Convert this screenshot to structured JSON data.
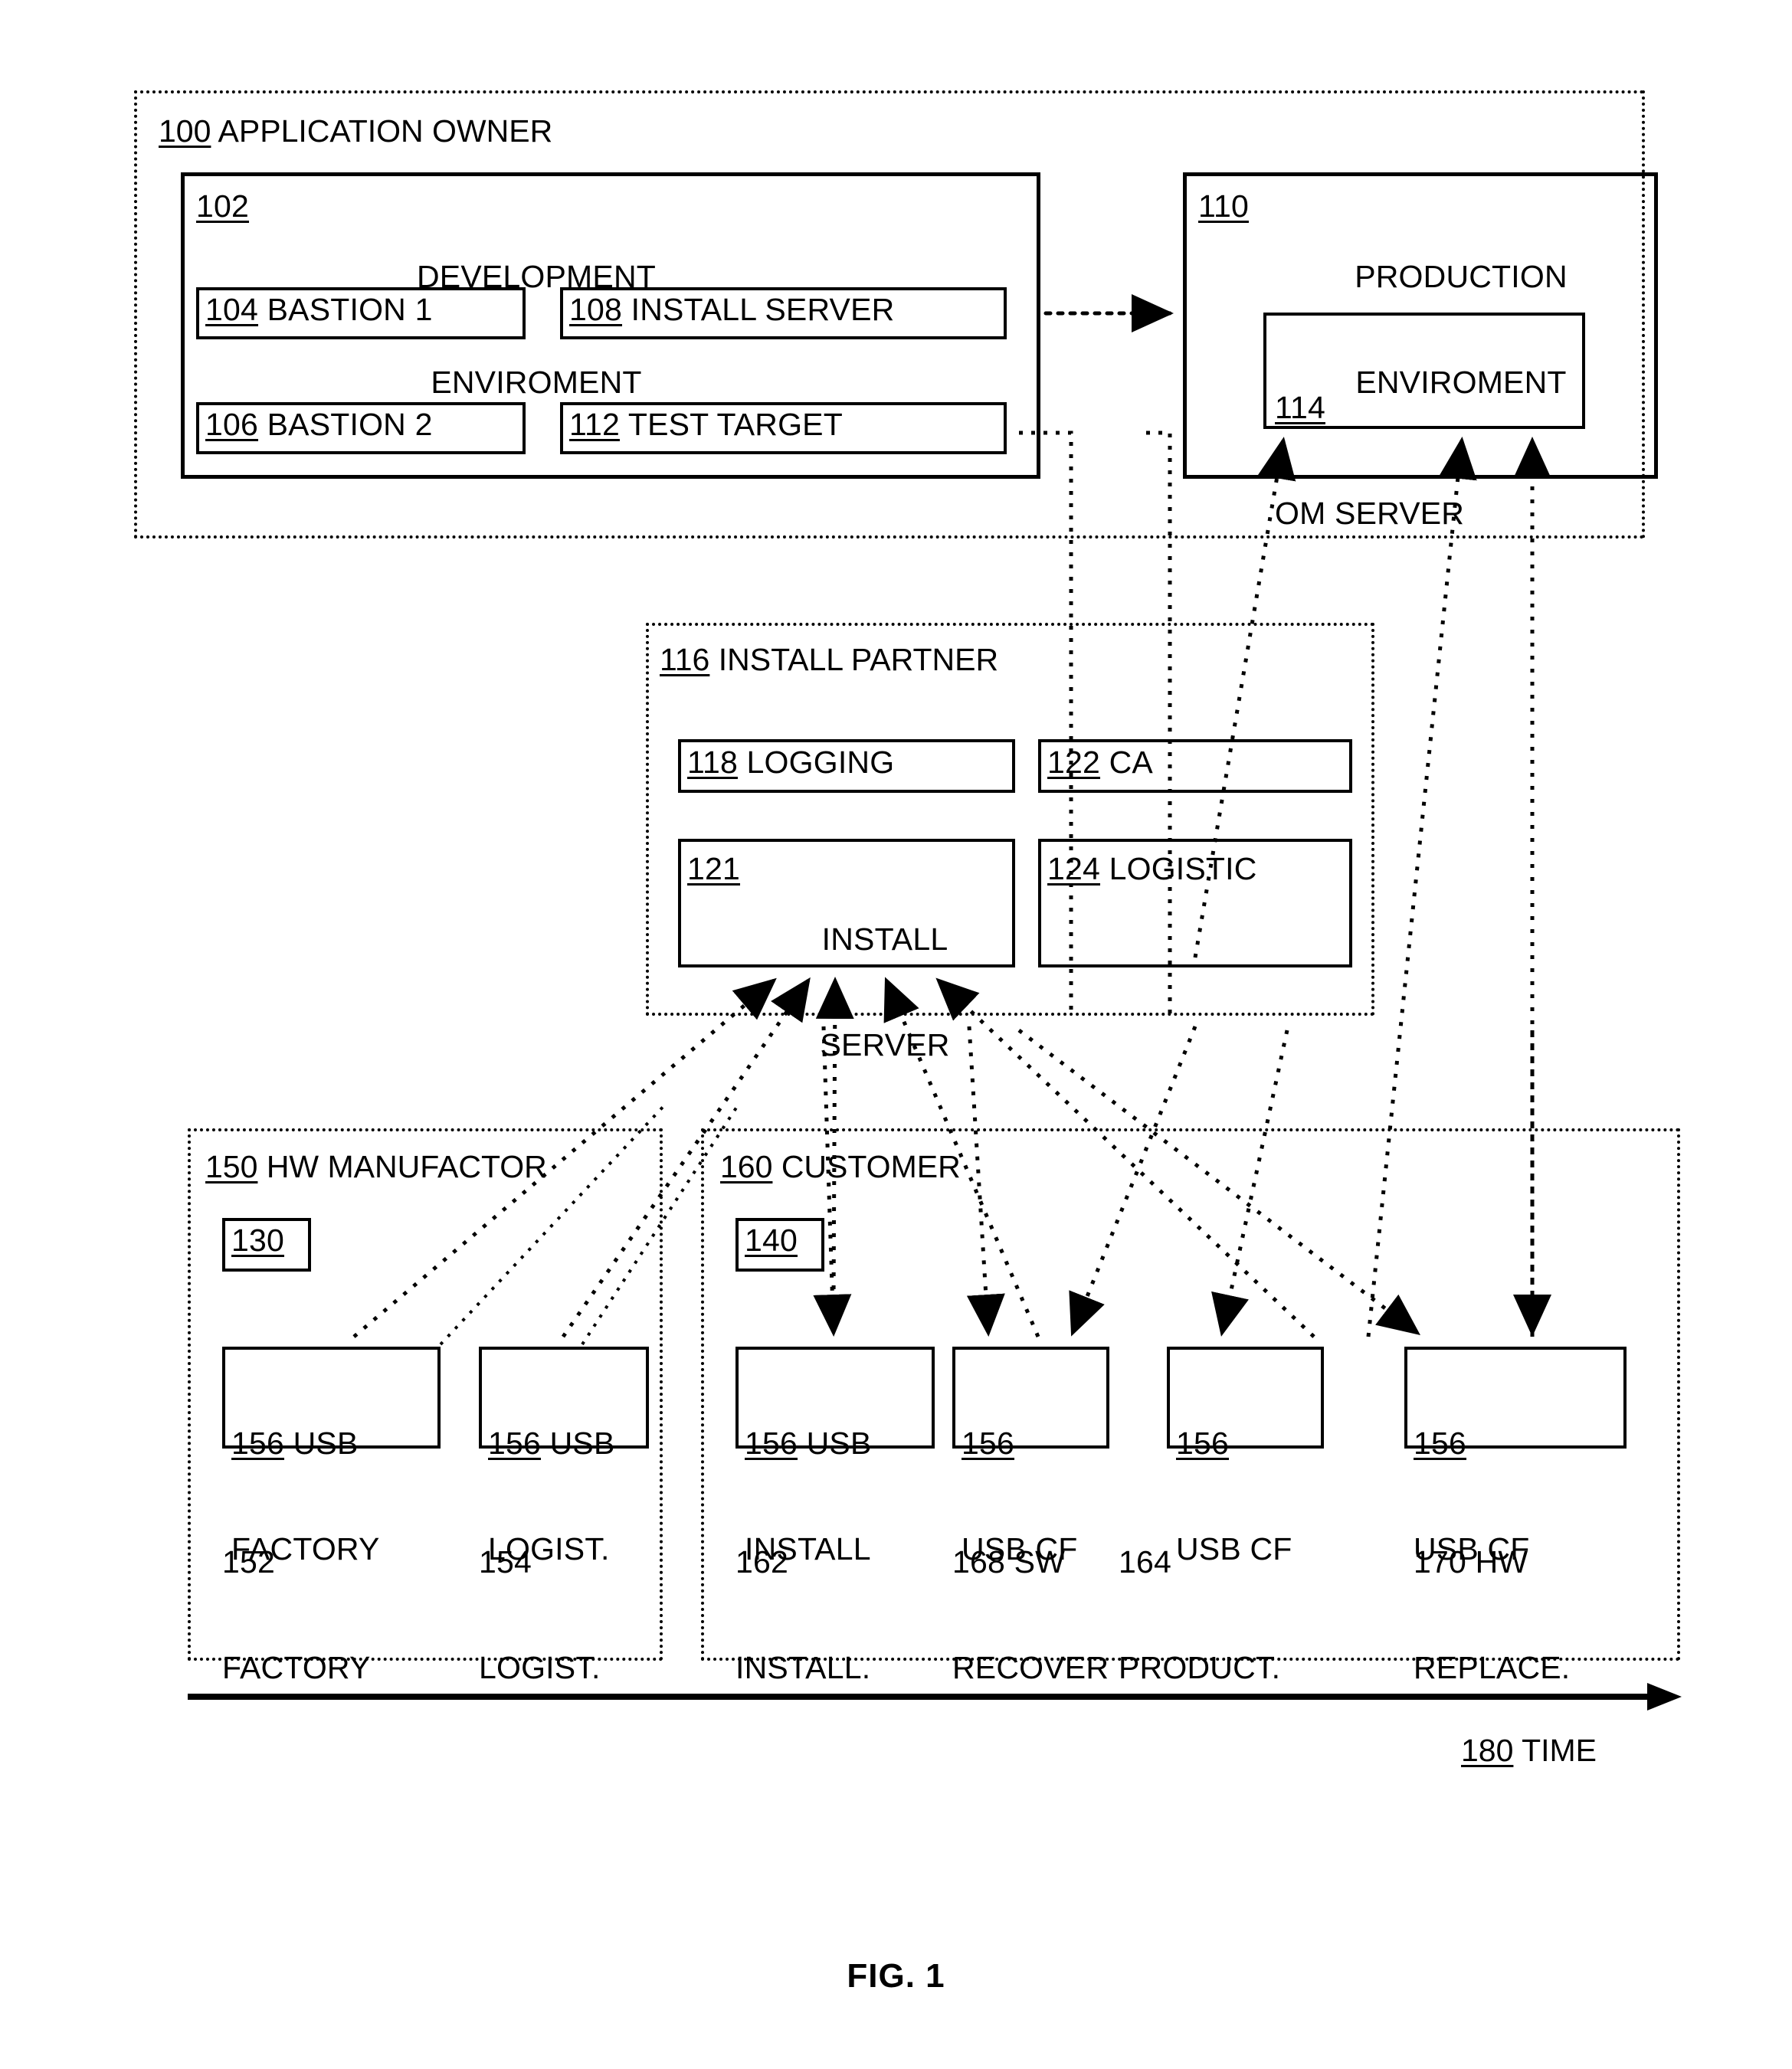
{
  "figure": {
    "caption": "FIG. 1"
  },
  "zones": {
    "application_owner": {
      "ref": "100",
      "label": " APPLICATION OWNER"
    },
    "install_partner": {
      "ref": "116",
      "label": " INSTALL PARTNER"
    },
    "hw_manufactor": {
      "ref": "150",
      "label": " HW MANUFACTOR"
    },
    "customer": {
      "ref": "160",
      "label": " CUSTOMER"
    }
  },
  "boxes": {
    "development_environment": {
      "ref": "102",
      "line1": "DEVELOPMENT",
      "line2": "ENVIROMENT"
    },
    "bastion1": {
      "ref": "104",
      "label": " BASTION 1"
    },
    "bastion2": {
      "ref": "106",
      "label": " BASTION 2"
    },
    "install_server_dev": {
      "ref": "108",
      "label": " INSTALL SERVER"
    },
    "test_target": {
      "ref": "112",
      "label": " TEST TARGET"
    },
    "production_environment": {
      "ref": "110",
      "line1": "PRODUCTION",
      "line2": "ENVIROMENT"
    },
    "om_server": {
      "ref": "114",
      "label": "OM SERVER"
    },
    "logging": {
      "ref": "118",
      "label": " LOGGING"
    },
    "ca": {
      "ref": "122",
      "label": " CA"
    },
    "install_server_partner": {
      "ref": "121",
      "line1": "INSTALL",
      "line2": "SERVER"
    },
    "logistic": {
      "ref": "124",
      "label": " LOGISTIC"
    },
    "hw_node_130": {
      "ref": "130"
    },
    "customer_node_140": {
      "ref": "140"
    }
  },
  "usb_items": [
    {
      "ref": "156",
      "line1": " USB",
      "line2": "FACTORY",
      "caption_ref": "152",
      "caption_text": "FACTORY"
    },
    {
      "ref": "156",
      "line1": " USB",
      "line2": "LOGIST.",
      "caption_ref": "154",
      "caption_text": "LOGIST."
    },
    {
      "ref": "156",
      "line1": " USB",
      "line2": "INSTALL",
      "caption_ref": "162",
      "caption_text": "INSTALL."
    },
    {
      "ref": "156",
      "line1": "",
      "line2": "USB CF",
      "caption_ref": "168 SW",
      "caption_text": "RECOVER"
    },
    {
      "ref": "156",
      "line1": "",
      "line2": "USB CF",
      "caption_ref": "164",
      "caption_text": "PRODUCT."
    },
    {
      "ref": "156",
      "line1": "",
      "line2": "USB CF",
      "caption_ref": "170 HW",
      "caption_text": "REPLACE."
    }
  ],
  "timeline": {
    "ref": "180",
    "label": " TIME"
  },
  "colors": {
    "ink": "#000000",
    "paper": "#ffffff"
  }
}
